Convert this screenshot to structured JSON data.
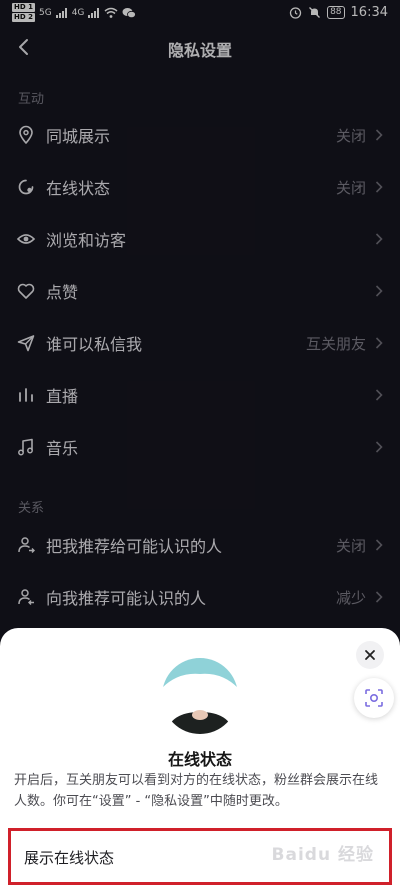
{
  "status_bar": {
    "hd1": "HD 1",
    "hd2": "HD 2",
    "network": "5G",
    "network2": "4G",
    "battery": "88",
    "time": "16:34"
  },
  "header": {
    "title": "隐私设置"
  },
  "sections": [
    {
      "title": "互动",
      "items": [
        {
          "icon": "location-pin-icon",
          "label": "同城展示",
          "value": "关闭"
        },
        {
          "icon": "online-status-icon",
          "label": "在线状态",
          "value": "关闭"
        },
        {
          "icon": "eye-icon",
          "label": "浏览和访客",
          "value": ""
        },
        {
          "icon": "heart-icon",
          "label": "点赞",
          "value": ""
        },
        {
          "icon": "send-icon",
          "label": "谁可以私信我",
          "value": "互关朋友"
        },
        {
          "icon": "live-bars-icon",
          "label": "直播",
          "value": ""
        },
        {
          "icon": "music-note-icon",
          "label": "音乐",
          "value": ""
        }
      ]
    },
    {
      "title": "关系",
      "items": [
        {
          "icon": "recommend-me-icon",
          "label": "把我推荐给可能认识的人",
          "value": "关闭"
        },
        {
          "icon": "recommend-to-me-icon",
          "label": "向我推荐可能认识的人",
          "value": "减少"
        }
      ]
    }
  ],
  "sheet": {
    "title": "在线状态",
    "description": "开启后，互关朋友可以看到对方的在线状态，粉丝群会展示在线人数。你可在“设置” - “隐私设置”中随时更改。",
    "toggle_label": "展示在线状态",
    "watermark": "Baidu 经验"
  },
  "colors": {
    "background": "#16151f",
    "sheet": "#ffffff",
    "highlight": "#d0202a",
    "secondary_text": "#7e7d88"
  }
}
